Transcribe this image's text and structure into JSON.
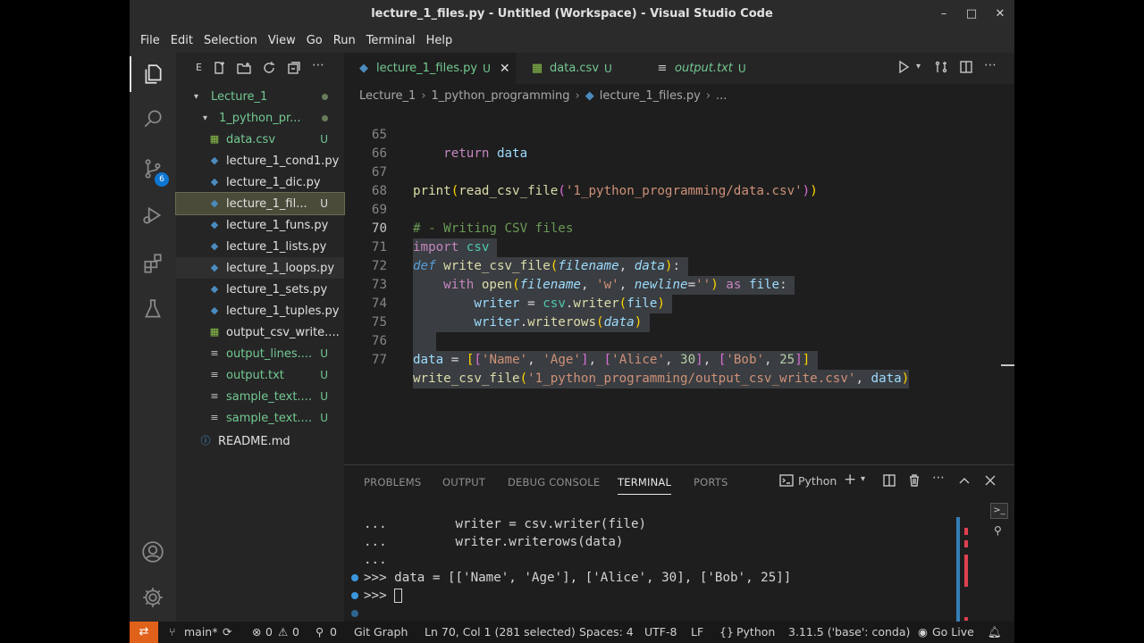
{
  "window": {
    "title": "lecture_1_files.py - Untitled (Workspace) - Visual Studio Code",
    "minimize": "–",
    "maximize": "□",
    "close": "✕"
  },
  "menu": [
    "File",
    "Edit",
    "Selection",
    "View",
    "Go",
    "Run",
    "Terminal",
    "Help"
  ],
  "activity": {
    "scm_badge": "6"
  },
  "sidebar": {
    "header_label": "E",
    "tree": [
      {
        "label": "Lecture_1",
        "kind": "folder",
        "status": "dot"
      },
      {
        "label": "1_python_pr...",
        "kind": "folder",
        "status": "dot"
      },
      {
        "label": "data.csv",
        "kind": "csv",
        "status": "U"
      },
      {
        "label": "lecture_1_cond1.py",
        "kind": "py",
        "status": ""
      },
      {
        "label": "lecture_1_dic.py",
        "kind": "py",
        "status": ""
      },
      {
        "label": "lecture_1_fil...",
        "kind": "py",
        "status": "U"
      },
      {
        "label": "lecture_1_funs.py",
        "kind": "py",
        "status": ""
      },
      {
        "label": "lecture_1_lists.py",
        "kind": "py",
        "status": ""
      },
      {
        "label": "lecture_1_loops.py",
        "kind": "py",
        "status": ""
      },
      {
        "label": "lecture_1_sets.py",
        "kind": "py",
        "status": ""
      },
      {
        "label": "lecture_1_tuples.py",
        "kind": "py",
        "status": ""
      },
      {
        "label": "output_csv_write....",
        "kind": "csv",
        "status": ""
      },
      {
        "label": "output_lines....",
        "kind": "txt",
        "status": "U"
      },
      {
        "label": "output.txt",
        "kind": "txt",
        "status": "U"
      },
      {
        "label": "sample_text....",
        "kind": "txt",
        "status": "U"
      },
      {
        "label": "sample_text....",
        "kind": "txt",
        "status": "U"
      },
      {
        "label": "README.md",
        "kind": "info",
        "status": ""
      }
    ]
  },
  "tabs": [
    {
      "label": "lecture_1_files.py",
      "status": "U",
      "active": true
    },
    {
      "label": "data.csv",
      "status": "U",
      "active": false
    },
    {
      "label": "output.txt",
      "status": "U",
      "active": false
    }
  ],
  "breadcrumb": [
    "Lecture_1",
    "1_python_programming",
    "lecture_1_files.py",
    "..."
  ],
  "code_lines": [
    {
      "n": "65",
      "text": "    return data"
    },
    {
      "n": "66",
      "text": ""
    },
    {
      "n": "67",
      "text": "print(read_csv_file('1_python_programming/data.csv'))"
    },
    {
      "n": "68",
      "text": ""
    },
    {
      "n": "69",
      "text": "# - Writing CSV files"
    },
    {
      "n": "70",
      "text": "import csv"
    },
    {
      "n": "71",
      "text": "def write_csv_file(filename, data):"
    },
    {
      "n": "72",
      "text": "    with open(filename, 'w', newline='') as file:"
    },
    {
      "n": "73",
      "text": "        writer = csv.writer(file)"
    },
    {
      "n": "74",
      "text": "        writer.writerows(data)"
    },
    {
      "n": "75",
      "text": ""
    },
    {
      "n": "76",
      "text": "data = [['Name', 'Age'], ['Alice', 30], ['Bob', 25]]"
    },
    {
      "n": "77",
      "text": "write_csv_file('1_python_programming/output_csv_write.csv', data)"
    }
  ],
  "panel": {
    "tabs": [
      "PROBLEMS",
      "OUTPUT",
      "DEBUG CONSOLE",
      "TERMINAL",
      "PORTS"
    ],
    "active_tab": "TERMINAL",
    "shell": "Python",
    "terminal_lines": [
      "...         writer = csv.writer(file)",
      "...         writer.writerows(data)",
      "...",
      ">>> data = [['Name', 'Age'], ['Alice', 30], ['Bob', 25]]",
      ">>> "
    ]
  },
  "status": {
    "branch": "main*",
    "errors": "0",
    "warnings": "0",
    "ports": "0",
    "git_graph": "Git Graph",
    "position": "Ln 70, Col 1 (281 selected)",
    "spaces": "Spaces: 4",
    "encoding": "UTF-8",
    "eol": "LF",
    "language": "Python",
    "interpreter": "3.11.5 ('base': conda)",
    "go_live": "Go Live"
  }
}
